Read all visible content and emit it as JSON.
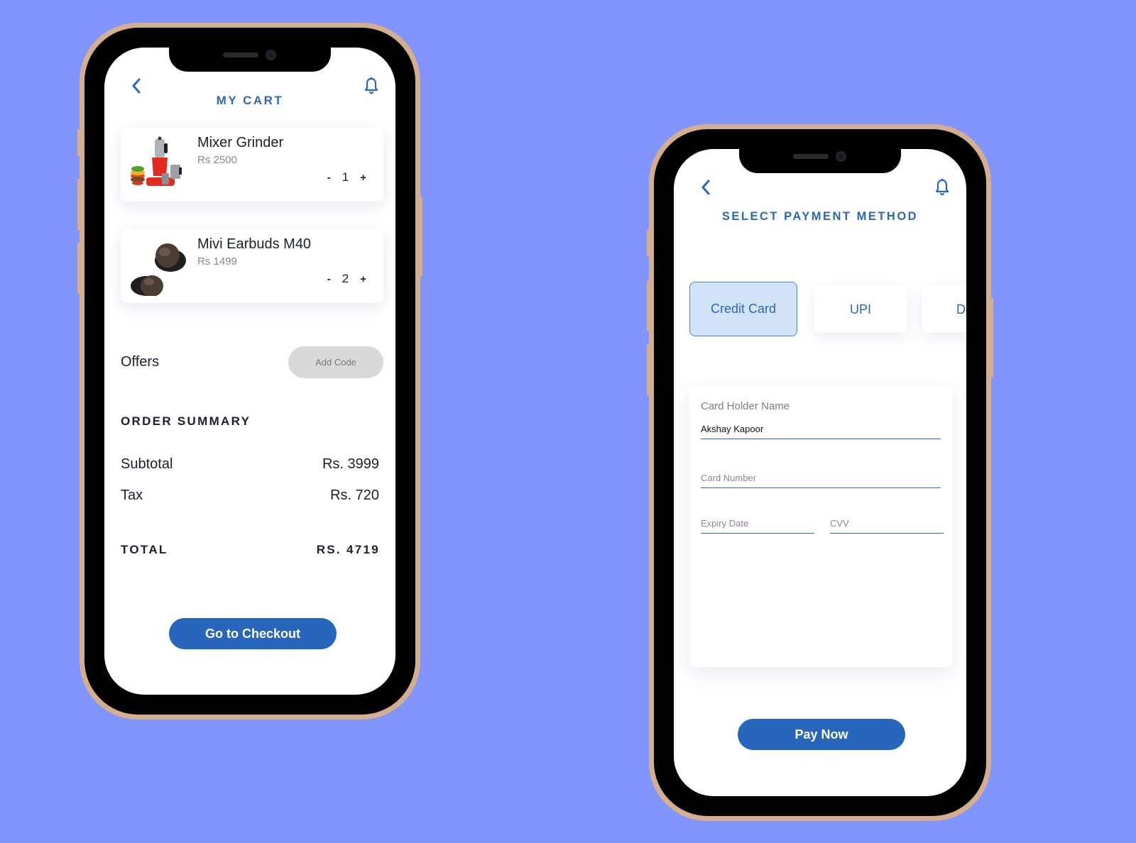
{
  "colors": {
    "background": "#8195fd",
    "accent": "#2866bd",
    "phone_frame": "#d3ae8f",
    "selected_method_bg": "#d3e3f7",
    "add_code_bg": "#d9d9d9"
  },
  "cart_screen": {
    "header": {
      "back_icon": "chevron-left-icon",
      "title": "MY CART",
      "notification_icon": "bell-icon"
    },
    "items": [
      {
        "name": "Mixer Grinder",
        "price": "Rs 2500",
        "quantity": "1",
        "decrement": "-",
        "increment": "+",
        "image": "mixer-grinder-image"
      },
      {
        "name": "Mivi Earbuds M40",
        "price": "Rs 1499",
        "quantity": "2",
        "decrement": "-",
        "increment": "+",
        "image": "earbuds-image"
      }
    ],
    "offers": {
      "label": "Offers",
      "add_code_label": "Add Code"
    },
    "order_summary": {
      "heading": "ORDER SUMMARY",
      "subtotal_label": "Subtotal",
      "subtotal_value": "Rs. 3999",
      "tax_label": "Tax",
      "tax_value": "Rs. 720",
      "total_label": "TOTAL",
      "total_value": "RS. 4719"
    },
    "checkout_label": "Go to Checkout"
  },
  "payment_screen": {
    "header": {
      "back_icon": "chevron-left-icon",
      "title": "SELECT PAYMENT METHOD",
      "notification_icon": "bell-icon"
    },
    "methods": [
      {
        "label": "Credit Card",
        "selected": true
      },
      {
        "label": "UPI",
        "selected": false
      },
      {
        "label": "De",
        "selected": false
      }
    ],
    "form": {
      "section_label": "Card Holder Name",
      "card_holder_value": "Akshay Kapoor",
      "card_number_placeholder": "Card Number",
      "expiry_placeholder": "Expiry Date",
      "cvv_placeholder": "CVV"
    },
    "pay_label": "Pay Now"
  }
}
